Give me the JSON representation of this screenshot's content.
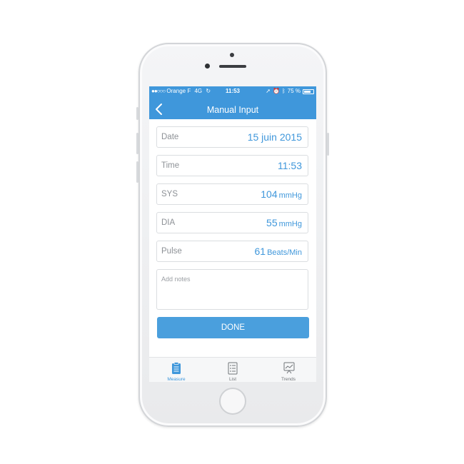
{
  "status_bar": {
    "carrier": "Orange F",
    "network": "4G",
    "time": "11:53",
    "battery": "75 %",
    "battery_level": 0.75
  },
  "nav": {
    "title": "Manual Input",
    "back_icon": "chevron-left-icon"
  },
  "form": {
    "date": {
      "label": "Date",
      "value": "15 juin 2015"
    },
    "time": {
      "label": "Time",
      "value": "11:53"
    },
    "sys": {
      "label": "SYS",
      "value": "104",
      "unit": "mmHg"
    },
    "dia": {
      "label": "DIA",
      "value": "55",
      "unit": "mmHg"
    },
    "pulse": {
      "label": "Pulse",
      "value": "61",
      "unit": "Beats/Min"
    },
    "notes_placeholder": "Add notes",
    "done_label": "DONE"
  },
  "tabs": [
    {
      "label": "Measure",
      "icon": "clipboard-icon",
      "active": true
    },
    {
      "label": "List",
      "icon": "list-icon",
      "active": false
    },
    {
      "label": "Trends",
      "icon": "trends-chart-icon",
      "active": false
    }
  ],
  "colors": {
    "accent": "#3f97db",
    "button": "#4a9fdd",
    "label_gray": "#8d9196"
  }
}
